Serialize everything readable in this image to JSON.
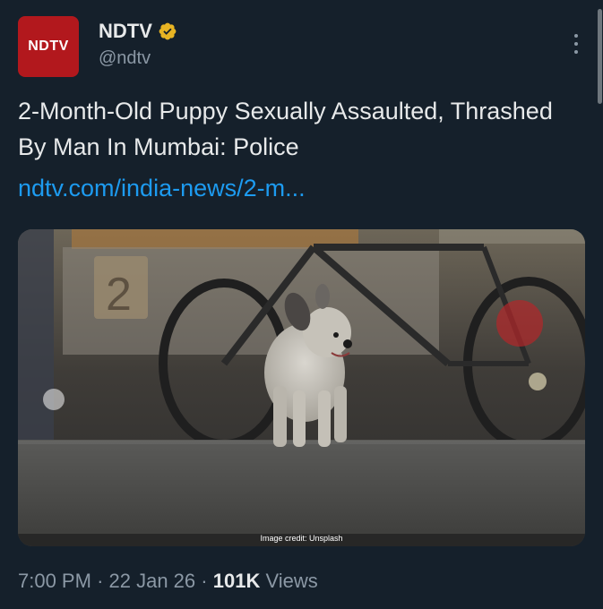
{
  "account": {
    "avatar_text": "NDTV",
    "display_name": "NDTV",
    "handle": "@ndtv",
    "verified_color": "#e8b423",
    "avatar_color": "#b2181d"
  },
  "tweet": {
    "text": "2-Month-Old Puppy Sexually Assaulted, Thrashed By Man In Mumbai: Police",
    "link": "ndtv.com/india-news/2-m...",
    "media": {
      "description_icon": "photo",
      "credit": "Image credit: Unsplash",
      "sign_text": "2"
    },
    "time": "7:00 PM",
    "separator": "·",
    "date": "22 Jan 26",
    "views_count": "101K",
    "views_label": "Views"
  },
  "colors": {
    "background": "#15202b",
    "link": "#1d9bf0",
    "secondary_text": "#8b98a5",
    "primary_text": "#e7e9ea"
  }
}
